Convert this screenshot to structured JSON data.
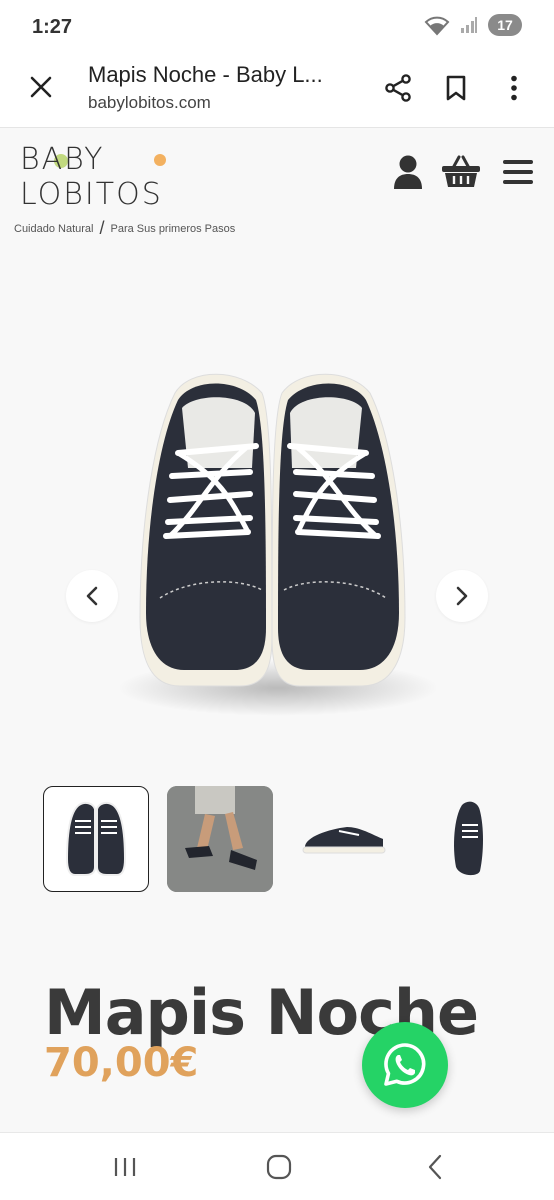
{
  "status": {
    "time": "1:27",
    "battery": "17"
  },
  "browser": {
    "title": "Mapis Noche - Baby L...",
    "url": "babylobitos.com"
  },
  "site": {
    "logo_text": "BABY LOBITOS",
    "tagline_left": "Cuidado Natural",
    "tagline_slash": "/",
    "tagline_right": "Para Sus primeros Pasos"
  },
  "icons": {
    "close": "close-icon",
    "share": "share-icon",
    "bookmark": "bookmark-icon",
    "menu": "more-vert-icon",
    "account": "user-icon",
    "cart": "basket-icon",
    "hamburger": "hamburger-icon",
    "prev": "chevron-left-icon",
    "next": "chevron-right-icon",
    "whatsapp": "whatsapp-icon"
  },
  "product": {
    "name": "Mapis Noche",
    "price": "70,00€",
    "thumbnails": [
      "front pair",
      "worn on feet",
      "side view",
      "top view single"
    ]
  },
  "colors": {
    "price": "#e0a25c",
    "whatsapp": "#25d366",
    "shoe": "#2b2f3a"
  }
}
